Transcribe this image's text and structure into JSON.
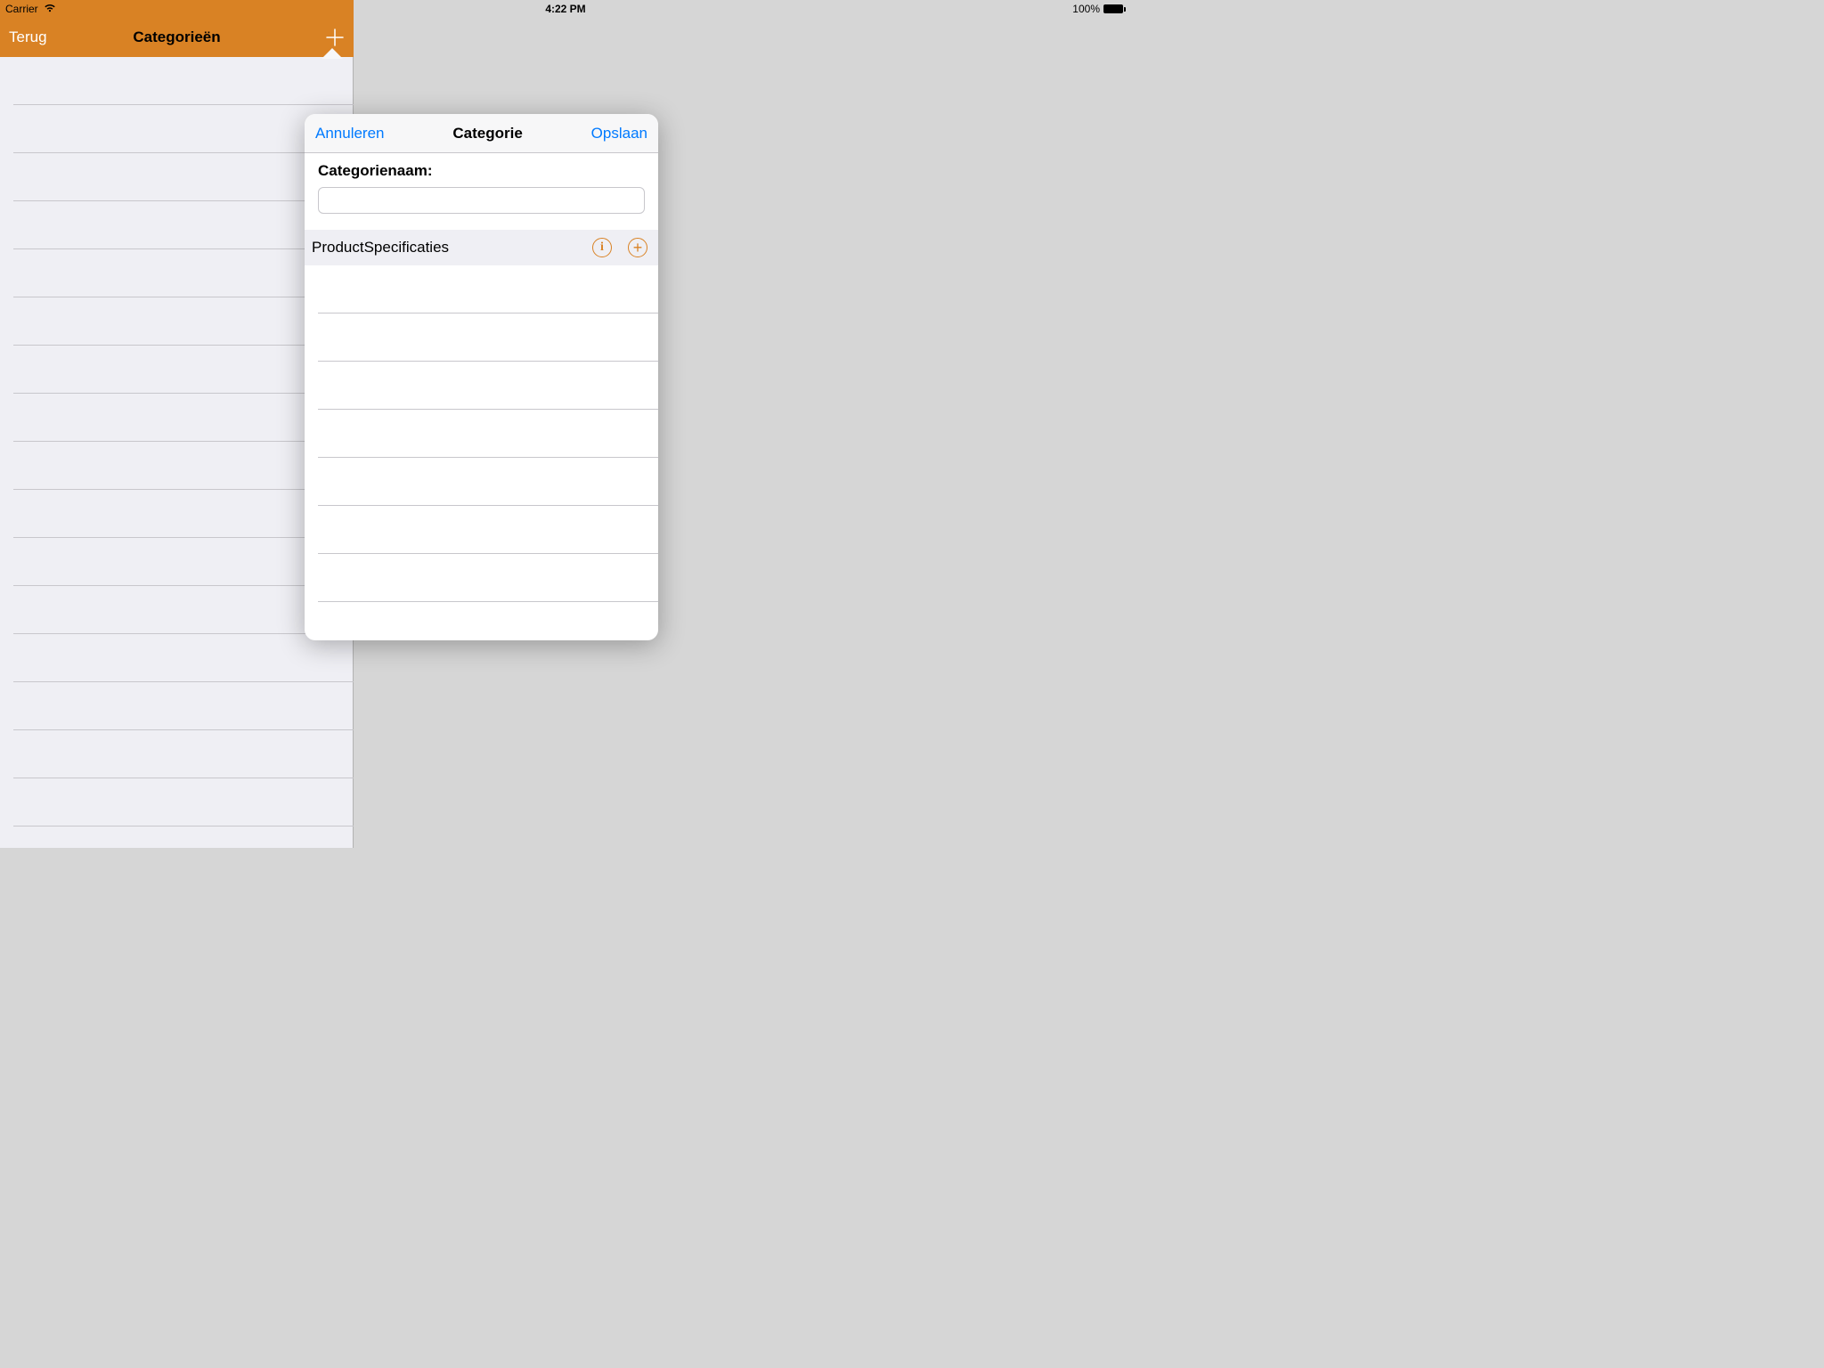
{
  "status": {
    "carrier": "Carrier",
    "time": "4:22 PM",
    "battery": "100%"
  },
  "sidebar": {
    "back": "Terug",
    "title": "Categorieën"
  },
  "popover": {
    "cancel": "Annuleren",
    "title": "Categorie",
    "save": "Opslaan",
    "label": "Categorienaam:",
    "input_value": "",
    "section_title": "ProductSpecificaties"
  }
}
